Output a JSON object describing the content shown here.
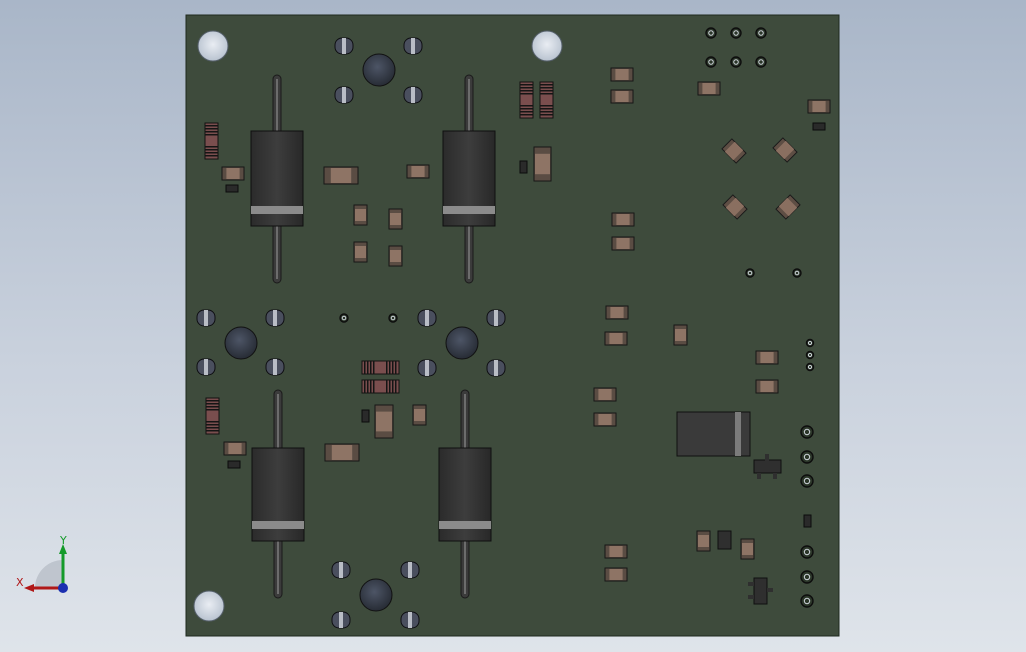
{
  "viewport": {
    "background_top": "#a9b6c8",
    "background_bottom": "#dfe4ea"
  },
  "board": {
    "pcb_color": "#3e4b3c",
    "edge_color": "#1f2a1e"
  },
  "triad": {
    "x_label": "X",
    "y_label": "Y",
    "x_color": "#b01818",
    "y_color": "#149a2a",
    "z_color": "#1b2fb0"
  },
  "components": {
    "diode_count": 4,
    "mounting_hole_count": 4
  }
}
